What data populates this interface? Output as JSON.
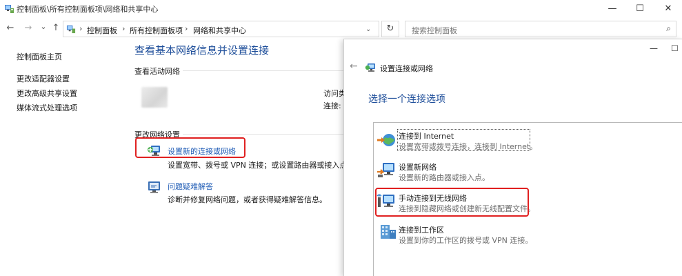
{
  "window": {
    "title": "控制面板\\所有控制面板项\\网络和共享中心",
    "minimize": "—",
    "maximize": "☐",
    "close": "✕"
  },
  "nav": {
    "back": "←",
    "forward": "→",
    "recent": "⌄",
    "up": "↑",
    "crumbs": [
      "控制面板",
      "所有控制面板项",
      "网络和共享中心"
    ],
    "crumb_sep": "›",
    "dropdown": "⌄",
    "refresh": "↻",
    "search_placeholder": "搜索控制面板",
    "search_icon": "⌕"
  },
  "sidebar": {
    "items": [
      "控制面板主页",
      "更改适配器设置",
      "更改高级共享设置",
      "媒体流式处理选项"
    ]
  },
  "main": {
    "title": "查看基本网络信息并设置连接",
    "active_label": "查看活动网络",
    "access_type_label": "访问类",
    "connections_label": "连接:",
    "change_label": "更改网络设置",
    "tasks": [
      {
        "link": "设置新的连接或网络",
        "desc": "设置宽带、拨号或 VPN 连接；或设置路由器或接入点。",
        "icon": "network-setup-icon"
      },
      {
        "link": "问题疑难解答",
        "desc": "诊断并修复网络问题，或者获得疑难解答信息。",
        "icon": "troubleshoot-icon"
      }
    ]
  },
  "dialog": {
    "minimize": "—",
    "maximize": "☐",
    "back": "←",
    "title": "设置连接或网络",
    "heading": "选择一个连接选项",
    "options": [
      {
        "title": "连接到 Internet",
        "desc": "设置宽带或拨号连接，连接到 Internet。",
        "icon": "globe-connect-icon"
      },
      {
        "title": "设置新网络",
        "desc": "设置新的路由器或接入点。",
        "icon": "new-network-icon"
      },
      {
        "title": "手动连接到无线网络",
        "desc": "连接到隐藏网络或创建新无线配置文件。",
        "icon": "wireless-network-icon"
      },
      {
        "title": "连接到工作区",
        "desc": "设置到你的工作区的拨号或 VPN 连接。",
        "icon": "workplace-icon"
      }
    ]
  },
  "colors": {
    "heading_blue": "#1e4e9a",
    "link_blue": "#1e5bb5",
    "highlight_red": "#e02020"
  }
}
